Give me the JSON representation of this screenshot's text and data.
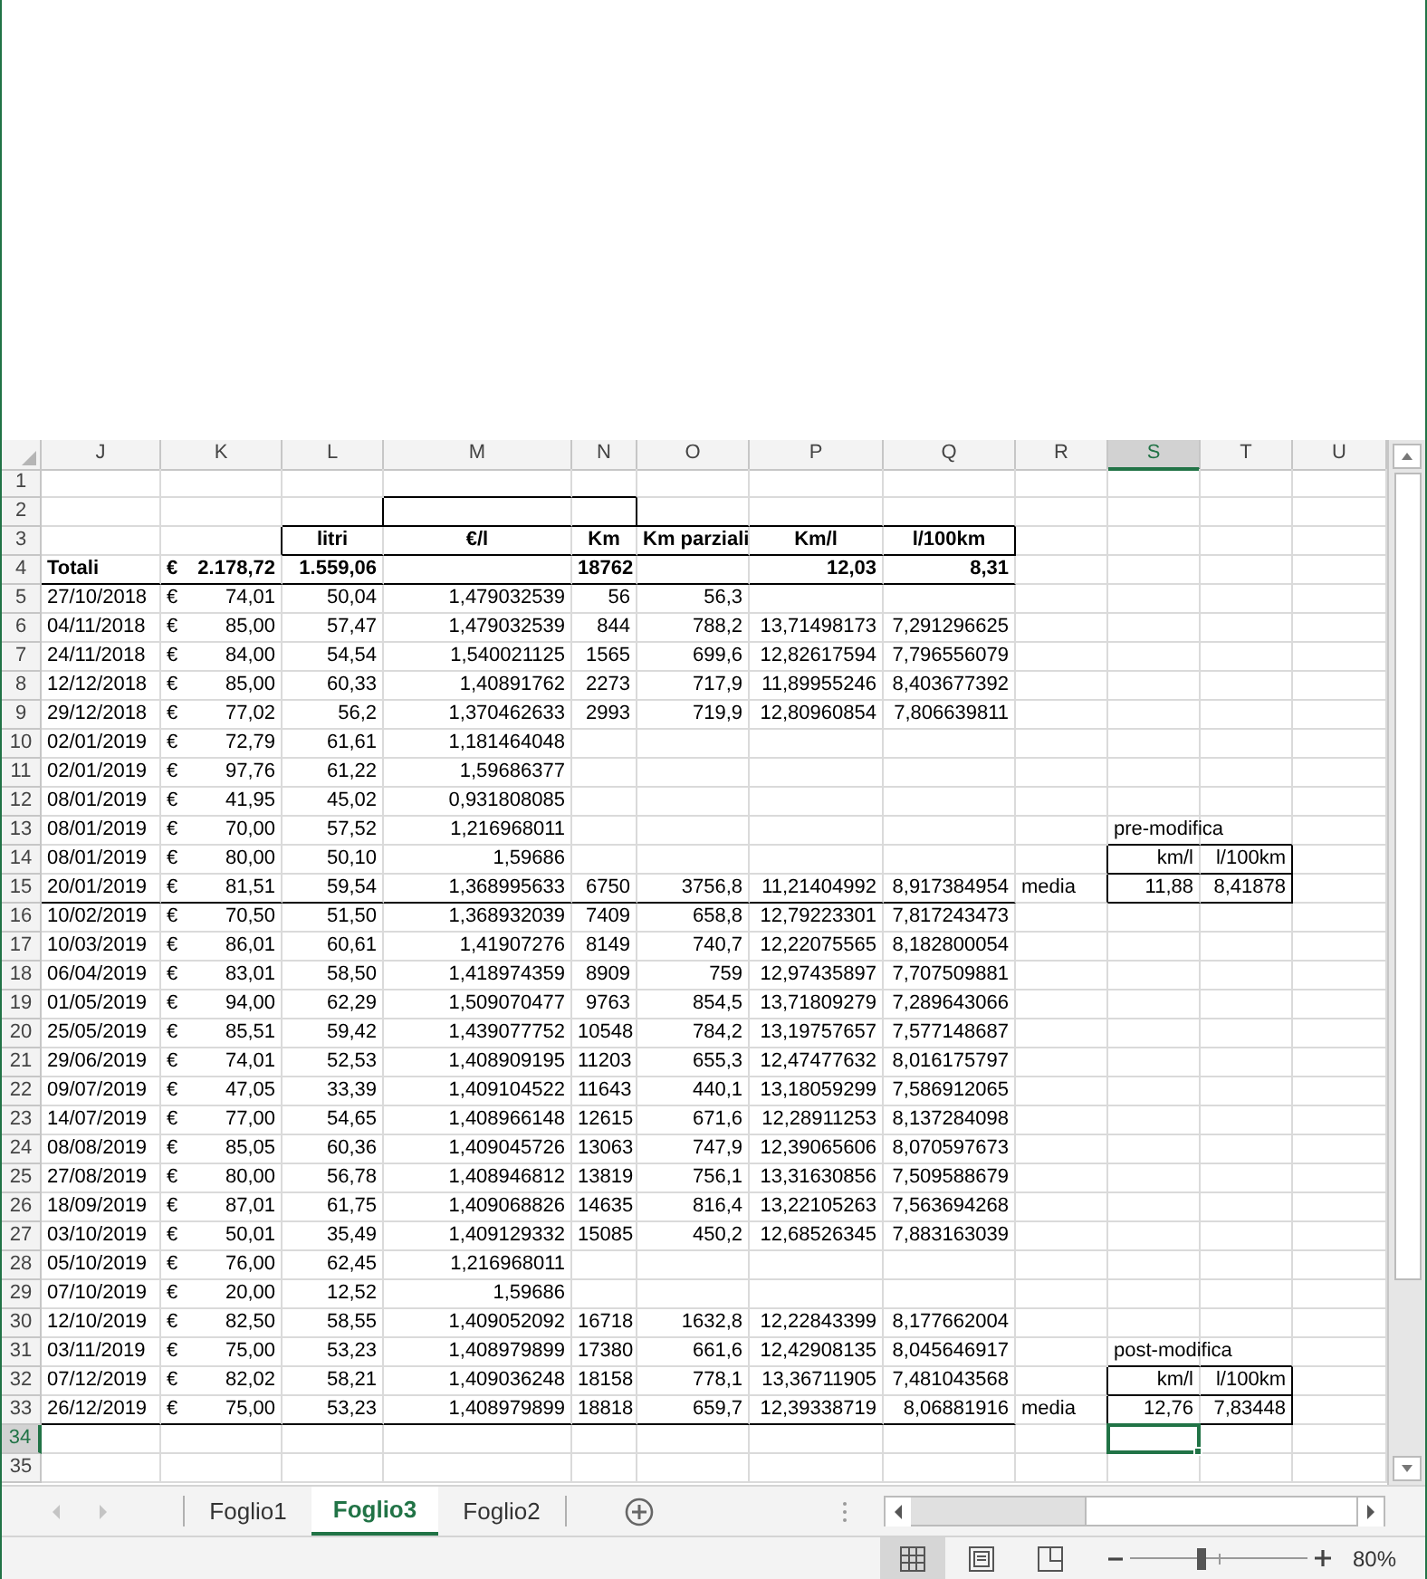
{
  "columns": [
    {
      "label": "J",
      "selected": false
    },
    {
      "label": "K",
      "selected": false
    },
    {
      "label": "L",
      "selected": false
    },
    {
      "label": "M",
      "selected": false
    },
    {
      "label": "N",
      "selected": false
    },
    {
      "label": "O",
      "selected": false
    },
    {
      "label": "P",
      "selected": false
    },
    {
      "label": "Q",
      "selected": false
    },
    {
      "label": "R",
      "selected": false
    },
    {
      "label": "S",
      "selected": true
    },
    {
      "label": "T",
      "selected": false
    },
    {
      "label": "U",
      "selected": false
    }
  ],
  "rows": [
    {
      "number": "1",
      "kind": "blank",
      "ruled": false,
      "selected": false
    },
    {
      "number": "2",
      "kind": "frame",
      "ruled": false,
      "selected": false
    },
    {
      "number": "3",
      "kind": "header",
      "ruled": false,
      "selected": false,
      "cells": [
        null,
        null,
        "litri",
        "€/l",
        "Km",
        "Km parziali",
        "Km/l",
        "l/100km",
        null,
        null,
        null,
        null
      ]
    },
    {
      "number": "4",
      "kind": "total",
      "ruled": true,
      "selected": false,
      "cells": [
        "Totali",
        {
          "symbol": "€",
          "amount": "2.178,72"
        },
        "1.559,06",
        null,
        "18762",
        null,
        "12,03",
        "8,31",
        null,
        null,
        null,
        null
      ]
    },
    {
      "number": "5",
      "kind": "data",
      "ruled": false,
      "selected": false,
      "cells": [
        "27/10/2018",
        {
          "symbol": "€",
          "amount": "74,01"
        },
        "50,04",
        "1,479032539",
        "56",
        "56,3",
        null,
        null,
        null,
        null,
        null,
        null
      ]
    },
    {
      "number": "6",
      "kind": "data",
      "ruled": false,
      "selected": false,
      "cells": [
        "04/11/2018",
        {
          "symbol": "€",
          "amount": "85,00"
        },
        "57,47",
        "1,479032539",
        "844",
        "788,2",
        "13,71498173",
        "7,291296625",
        null,
        null,
        null,
        null
      ]
    },
    {
      "number": "7",
      "kind": "data",
      "ruled": false,
      "selected": false,
      "cells": [
        "24/11/2018",
        {
          "symbol": "€",
          "amount": "84,00"
        },
        "54,54",
        "1,540021125",
        "1565",
        "699,6",
        "12,82617594",
        "7,796556079",
        null,
        null,
        null,
        null
      ]
    },
    {
      "number": "8",
      "kind": "data",
      "ruled": false,
      "selected": false,
      "cells": [
        "12/12/2018",
        {
          "symbol": "€",
          "amount": "85,00"
        },
        "60,33",
        "1,40891762",
        "2273",
        "717,9",
        "11,89955246",
        "8,403677392",
        null,
        null,
        null,
        null
      ]
    },
    {
      "number": "9",
      "kind": "data",
      "ruled": false,
      "selected": false,
      "cells": [
        "29/12/2018",
        {
          "symbol": "€",
          "amount": "77,02"
        },
        "56,2",
        "1,370462633",
        "2993",
        "719,9",
        "12,80960854",
        "7,806639811",
        null,
        null,
        null,
        null
      ]
    },
    {
      "number": "10",
      "kind": "data",
      "ruled": false,
      "selected": false,
      "cells": [
        "02/01/2019",
        {
          "symbol": "€",
          "amount": "72,79"
        },
        "61,61",
        "1,181464048",
        null,
        null,
        null,
        null,
        null,
        null,
        null,
        null
      ]
    },
    {
      "number": "11",
      "kind": "data",
      "ruled": false,
      "selected": false,
      "cells": [
        "02/01/2019",
        {
          "symbol": "€",
          "amount": "97,76"
        },
        "61,22",
        "1,59686377",
        null,
        null,
        null,
        null,
        null,
        null,
        null,
        null
      ]
    },
    {
      "number": "12",
      "kind": "data",
      "ruled": false,
      "selected": false,
      "cells": [
        "08/01/2019",
        {
          "symbol": "€",
          "amount": "41,95"
        },
        "45,02",
        "0,931808085",
        null,
        null,
        null,
        null,
        null,
        null,
        null,
        null
      ]
    },
    {
      "number": "13",
      "kind": "data",
      "ruled": false,
      "selected": false,
      "cells": [
        "08/01/2019",
        {
          "symbol": "€",
          "amount": "70,00"
        },
        "57,52",
        "1,216968011",
        null,
        null,
        null,
        null,
        null,
        {
          "text": "pre-modifica",
          "kind": "note"
        },
        null,
        null
      ]
    },
    {
      "number": "14",
      "kind": "data",
      "ruled": false,
      "selected": false,
      "cells": [
        "08/01/2019",
        {
          "symbol": "€",
          "amount": "80,00"
        },
        "50,10",
        "1,59686",
        null,
        null,
        null,
        null,
        null,
        {
          "text": "km/l",
          "kind": "boxed"
        },
        {
          "text": "l/100km",
          "kind": "boxed"
        },
        null
      ]
    },
    {
      "number": "15",
      "kind": "data",
      "ruled": true,
      "selected": false,
      "cells": [
        "20/01/2019",
        {
          "symbol": "€",
          "amount": "81,51"
        },
        "59,54",
        "1,368995633",
        "6750",
        "3756,8",
        "11,21404992",
        "8,917384954",
        "media",
        {
          "text": "11,88",
          "kind": "boxed"
        },
        {
          "text": "8,41878",
          "kind": "boxed"
        },
        null
      ]
    },
    {
      "number": "16",
      "kind": "data",
      "ruled": false,
      "selected": false,
      "cells": [
        "10/02/2019",
        {
          "symbol": "€",
          "amount": "70,50"
        },
        "51,50",
        "1,368932039",
        "7409",
        "658,8",
        "12,79223301",
        "7,817243473",
        null,
        null,
        null,
        null
      ]
    },
    {
      "number": "17",
      "kind": "data",
      "ruled": false,
      "selected": false,
      "cells": [
        "10/03/2019",
        {
          "symbol": "€",
          "amount": "86,01"
        },
        "60,61",
        "1,41907276",
        "8149",
        "740,7",
        "12,22075565",
        "8,182800054",
        null,
        null,
        null,
        null
      ]
    },
    {
      "number": "18",
      "kind": "data",
      "ruled": false,
      "selected": false,
      "cells": [
        "06/04/2019",
        {
          "symbol": "€",
          "amount": "83,01"
        },
        "58,50",
        "1,418974359",
        "8909",
        "759",
        "12,97435897",
        "7,707509881",
        null,
        null,
        null,
        null
      ]
    },
    {
      "number": "19",
      "kind": "data",
      "ruled": false,
      "selected": false,
      "cells": [
        "01/05/2019",
        {
          "symbol": "€",
          "amount": "94,00"
        },
        "62,29",
        "1,509070477",
        "9763",
        "854,5",
        "13,71809279",
        "7,289643066",
        null,
        null,
        null,
        null
      ]
    },
    {
      "number": "20",
      "kind": "data",
      "ruled": false,
      "selected": false,
      "cells": [
        "25/05/2019",
        {
          "symbol": "€",
          "amount": "85,51"
        },
        "59,42",
        "1,439077752",
        "10548",
        "784,2",
        "13,19757657",
        "7,577148687",
        null,
        null,
        null,
        null
      ]
    },
    {
      "number": "21",
      "kind": "data",
      "ruled": false,
      "selected": false,
      "cells": [
        "29/06/2019",
        {
          "symbol": "€",
          "amount": "74,01"
        },
        "52,53",
        "1,408909195",
        "11203",
        "655,3",
        "12,47477632",
        "8,016175797",
        null,
        null,
        null,
        null
      ]
    },
    {
      "number": "22",
      "kind": "data",
      "ruled": false,
      "selected": false,
      "cells": [
        "09/07/2019",
        {
          "symbol": "€",
          "amount": "47,05"
        },
        "33,39",
        "1,409104522",
        "11643",
        "440,1",
        "13,18059299",
        "7,586912065",
        null,
        null,
        null,
        null
      ]
    },
    {
      "number": "23",
      "kind": "data",
      "ruled": false,
      "selected": false,
      "cells": [
        "14/07/2019",
        {
          "symbol": "€",
          "amount": "77,00"
        },
        "54,65",
        "1,408966148",
        "12615",
        "671,6",
        "12,28911253",
        "8,137284098",
        null,
        null,
        null,
        null
      ]
    },
    {
      "number": "24",
      "kind": "data",
      "ruled": false,
      "selected": false,
      "cells": [
        "08/08/2019",
        {
          "symbol": "€",
          "amount": "85,05"
        },
        "60,36",
        "1,409045726",
        "13063",
        "747,9",
        "12,39065606",
        "8,070597673",
        null,
        null,
        null,
        null
      ]
    },
    {
      "number": "25",
      "kind": "data",
      "ruled": false,
      "selected": false,
      "cells": [
        "27/08/2019",
        {
          "symbol": "€",
          "amount": "80,00"
        },
        "56,78",
        "1,408946812",
        "13819",
        "756,1",
        "13,31630856",
        "7,509588679",
        null,
        null,
        null,
        null
      ]
    },
    {
      "number": "26",
      "kind": "data",
      "ruled": false,
      "selected": false,
      "cells": [
        "18/09/2019",
        {
          "symbol": "€",
          "amount": "87,01"
        },
        "61,75",
        "1,409068826",
        "14635",
        "816,4",
        "13,22105263",
        "7,563694268",
        null,
        null,
        null,
        null
      ]
    },
    {
      "number": "27",
      "kind": "data",
      "ruled": false,
      "selected": false,
      "cells": [
        "03/10/2019",
        {
          "symbol": "€",
          "amount": "50,01"
        },
        "35,49",
        "1,409129332",
        "15085",
        "450,2",
        "12,68526345",
        "7,883163039",
        null,
        null,
        null,
        null
      ]
    },
    {
      "number": "28",
      "kind": "data",
      "ruled": false,
      "selected": false,
      "cells": [
        "05/10/2019",
        {
          "symbol": "€",
          "amount": "76,00"
        },
        "62,45",
        "1,216968011",
        null,
        null,
        null,
        null,
        null,
        null,
        null,
        null
      ]
    },
    {
      "number": "29",
      "kind": "data",
      "ruled": false,
      "selected": false,
      "cells": [
        "07/10/2019",
        {
          "symbol": "€",
          "amount": "20,00"
        },
        "12,52",
        "1,59686",
        null,
        null,
        null,
        null,
        null,
        null,
        null,
        null
      ]
    },
    {
      "number": "30",
      "kind": "data",
      "ruled": false,
      "selected": false,
      "cells": [
        "12/10/2019",
        {
          "symbol": "€",
          "amount": "82,50"
        },
        "58,55",
        "1,409052092",
        "16718",
        "1632,8",
        "12,22843399",
        "8,177662004",
        null,
        null,
        null,
        null
      ]
    },
    {
      "number": "31",
      "kind": "data",
      "ruled": false,
      "selected": false,
      "cells": [
        "03/11/2019",
        {
          "symbol": "€",
          "amount": "75,00"
        },
        "53,23",
        "1,408979899",
        "17380",
        "661,6",
        "12,42908135",
        "8,045646917",
        null,
        {
          "text": "post-modifica",
          "kind": "note"
        },
        null,
        null
      ]
    },
    {
      "number": "32",
      "kind": "data",
      "ruled": false,
      "selected": false,
      "cells": [
        "07/12/2019",
        {
          "symbol": "€",
          "amount": "82,02"
        },
        "58,21",
        "1,409036248",
        "18158",
        "778,1",
        "13,36711905",
        "7,481043568",
        null,
        {
          "text": "km/l",
          "kind": "boxed"
        },
        {
          "text": "l/100km",
          "kind": "boxed"
        },
        null
      ]
    },
    {
      "number": "33",
      "kind": "data",
      "ruled": true,
      "selected": false,
      "cells": [
        "26/12/2019",
        {
          "symbol": "€",
          "amount": "75,00"
        },
        "53,23",
        "1,408979899",
        "18818",
        "659,7",
        "12,39338719",
        "8,06881916",
        "media",
        {
          "text": "12,76",
          "kind": "boxed"
        },
        {
          "text": "7,83448",
          "kind": "boxed"
        },
        null
      ]
    },
    {
      "number": "34",
      "kind": "blank",
      "ruled": false,
      "selected": true
    },
    {
      "number": "35",
      "kind": "blank",
      "ruled": false,
      "selected": false
    }
  ],
  "sheet_tabs": [
    {
      "label": "Foglio1",
      "selected": false
    },
    {
      "label": "Foglio3",
      "selected": true
    },
    {
      "label": "Foglio2",
      "selected": false
    }
  ],
  "views": [
    {
      "kind": "normal",
      "selected": true
    },
    {
      "kind": "page_layout",
      "selected": false
    },
    {
      "kind": "page_break",
      "selected": false
    }
  ],
  "zoom": {
    "level": 0.4,
    "reading": "80%"
  }
}
